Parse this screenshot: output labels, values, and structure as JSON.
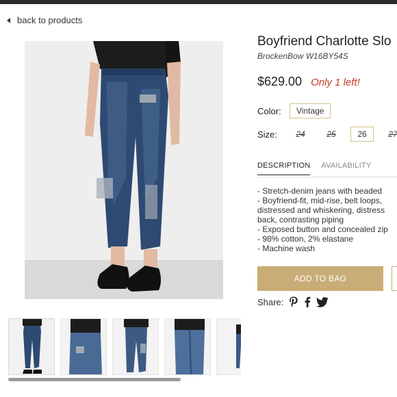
{
  "nav": {
    "back_label": "back to products"
  },
  "product": {
    "title": "Boyfriend Charlotte Slo",
    "brand": "BrockenBow W16BY54S",
    "price": "$629.00",
    "stock_note": "Only 1 left!",
    "color_label": "Color:",
    "color_value": "Vintage",
    "size_label": "Size:",
    "sizes": [
      {
        "value": "24",
        "available": false
      },
      {
        "value": "25",
        "available": false
      },
      {
        "value": "26",
        "available": true,
        "selected": true
      },
      {
        "value": "27",
        "available": false
      }
    ]
  },
  "tabs": [
    {
      "label": "DESCRIPTION",
      "active": true
    },
    {
      "label": "AVAILABILITY",
      "active": false
    }
  ],
  "description_lines": [
    "- Stretch-denim jeans with beaded",
    "- Boyfriend-fit, mid-rise, belt loops,",
    "distressed and whiskering, distress",
    "back, contrasting piping",
    "- Exposed button and concealed zip",
    "- 98% cotton, 2% elastane",
    "- Machine wash"
  ],
  "actions": {
    "add_to_bag": "ADD TO BAG"
  },
  "share": {
    "label": "Share:",
    "icons": [
      "pinterest-icon",
      "facebook-icon",
      "twitter-icon"
    ]
  },
  "colors": {
    "accent": "#c9ad76",
    "stock": "#c0392b",
    "topbar": "#2b2b2b"
  }
}
